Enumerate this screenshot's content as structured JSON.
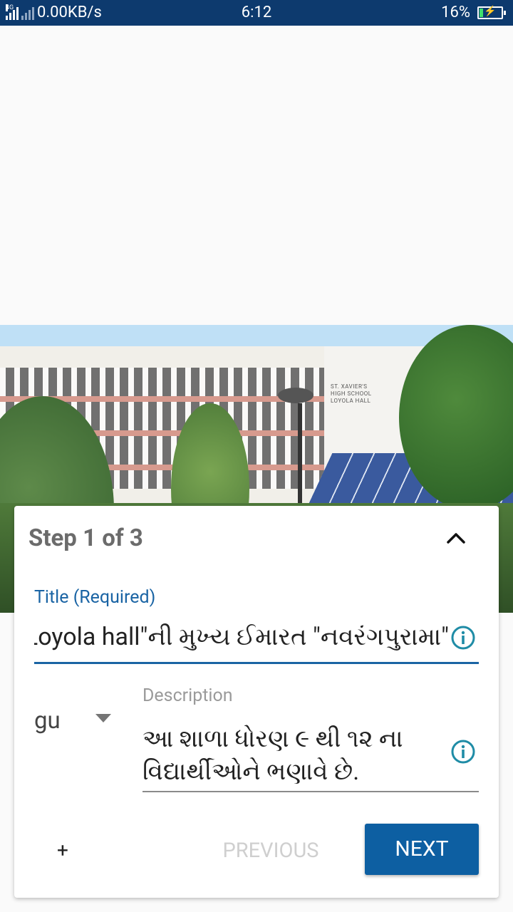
{
  "status_bar": {
    "network_tag": "4G",
    "speed": "0.00KB/s",
    "time": "6:12",
    "battery_percent": "16%",
    "battery_level": 0.16
  },
  "form": {
    "step_title": "Step 1 of 3",
    "title_label": "Title (Required)",
    "title_value": "\"Loyola hall\"ની મુખ્ય ઈમારત \"નવરંગપુરામા\"",
    "language_value": "gu",
    "description_label": "Description",
    "description_value": "આ શાળા ધોરણ ૯ થી ૧૨ ના વિદ્યાર્થીઓને ભણાવે છે.",
    "add_label": "+",
    "previous_label": "PREVIOUS",
    "next_label": "NEXT"
  },
  "photo": {
    "sign_text": "ST. XAVIER'S HIGH SCHOOL LOYOLA HALL"
  },
  "colors": {
    "status_bar": "#0d3a6e",
    "accent": "#1a64a4",
    "next_button": "#0d5fa2",
    "info_icon": "#1f8ca6"
  }
}
